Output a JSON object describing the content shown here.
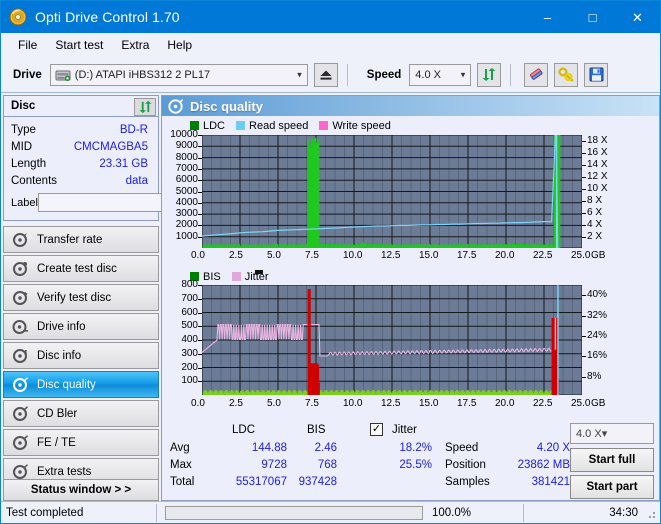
{
  "window": {
    "title": "Opti Drive Control 1.70",
    "icon": "disc-icon",
    "minimize": "–",
    "maximize": "□",
    "close": "✕"
  },
  "menu": [
    {
      "label": "File",
      "name": "menu-file"
    },
    {
      "label": "Start test",
      "name": "menu-start-test"
    },
    {
      "label": "Extra",
      "name": "menu-extra"
    },
    {
      "label": "Help",
      "name": "menu-help"
    }
  ],
  "toolbar": {
    "drive_label": "Drive",
    "drive_value": "(D:)  ATAPI iHBS312  2 PL17",
    "eject_icon": "eject-icon",
    "speed_label": "Speed",
    "speed_value": "4.0 X",
    "refresh_icon": "refresh-icon",
    "eraser_icon": "eraser-icon",
    "tools_icon": "tools-icon",
    "save_icon": "save-icon"
  },
  "disc": {
    "header": "Disc",
    "refresh_icon": "refresh-icon",
    "rows": [
      {
        "key": "Type",
        "value": "BD-R"
      },
      {
        "key": "MID",
        "value": "CMCMAGBA5"
      },
      {
        "key": "Length",
        "value": "23.31 GB"
      },
      {
        "key": "Contents",
        "value": "data"
      }
    ],
    "label_key": "Label",
    "label_value": "",
    "label_placeholder": "",
    "label_button_icon": "cd-disc-icon"
  },
  "nav": {
    "items": [
      {
        "label": "Transfer rate",
        "icon": "disc-speed-icon",
        "selected": false
      },
      {
        "label": "Create test disc",
        "icon": "disc-write-icon",
        "selected": false
      },
      {
        "label": "Verify test disc",
        "icon": "disc-verify-icon",
        "selected": false
      },
      {
        "label": "Drive info",
        "icon": "drive-info-icon",
        "selected": false
      },
      {
        "label": "Disc info",
        "icon": "disc-info-icon",
        "selected": false
      },
      {
        "label": "Disc quality",
        "icon": "disc-quality-icon",
        "selected": true
      },
      {
        "label": "CD Bler",
        "icon": "cd-bler-icon",
        "selected": false
      },
      {
        "label": "FE / TE",
        "icon": "fete-icon",
        "selected": false
      },
      {
        "label": "Extra tests",
        "icon": "extra-tests-icon",
        "selected": false
      }
    ],
    "status_window": "Status window > >"
  },
  "panel": {
    "title": "Disc quality",
    "icon": "disc-quality-icon"
  },
  "chart_data": [
    {
      "name": "top-chart",
      "type": "line",
      "title": "",
      "xlabel": "GB",
      "ylabel": "",
      "xlim": [
        0,
        25
      ],
      "ylim": [
        0,
        10000
      ],
      "y2lim": [
        0,
        18
      ],
      "y2label": "X",
      "grid": true,
      "legend_position": "top-left",
      "xticks": [
        "0.0",
        "2.5",
        "5.0",
        "7.5",
        "10.0",
        "12.5",
        "15.0",
        "17.5",
        "20.0",
        "22.5",
        "25.0"
      ],
      "yticks": [
        "10000",
        "9000",
        "8000",
        "7000",
        "6000",
        "5000",
        "4000",
        "3000",
        "2000",
        "1000"
      ],
      "y2ticks": [
        "18 X",
        "16 X",
        "14 X",
        "12 X",
        "10 X",
        "8 X",
        "6 X",
        "4 X",
        "2 X"
      ],
      "legend": [
        {
          "label": "LDC",
          "color": "#008000"
        },
        {
          "label": "Read speed",
          "color": "#6ecbf5"
        },
        {
          "label": "Write speed",
          "color": "#ff66cc"
        }
      ],
      "series": [
        {
          "name": "LDC",
          "color": "#1ec81e",
          "kind": "bar",
          "x": [
            0.1,
            0.4,
            0.8,
            1.2,
            1.6,
            2.0,
            2.4,
            2.8,
            3.2,
            3.6,
            4.0,
            4.4,
            4.8,
            5.2,
            5.6,
            6.0,
            6.4,
            6.8,
            7.0,
            7.15,
            7.25,
            7.35,
            7.45,
            7.55,
            7.65,
            7.8,
            8.2,
            8.6,
            9.0,
            9.4,
            9.8,
            10.2,
            10.6,
            11.0,
            11.4,
            11.8,
            12.2,
            12.6,
            13.0,
            13.4,
            13.8,
            14.2,
            14.6,
            15.0,
            15.4,
            15.8,
            16.2,
            16.6,
            17.0,
            17.4,
            17.8,
            18.2,
            18.6,
            19.0,
            19.4,
            19.8,
            20.2,
            20.6,
            21.0,
            21.4,
            21.8,
            22.2,
            22.6,
            23.0,
            23.2,
            23.3,
            23.4,
            23.5
          ],
          "values": [
            140,
            200,
            160,
            230,
            180,
            250,
            200,
            170,
            260,
            190,
            220,
            280,
            200,
            240,
            180,
            300,
            220,
            190,
            9600,
            9100,
            9700,
            9200,
            9750,
            9300,
            9650,
            250,
            300,
            220,
            260,
            330,
            240,
            280,
            500,
            260,
            300,
            230,
            280,
            320,
            240,
            290,
            250,
            310,
            230,
            270,
            300,
            250,
            280,
            330,
            260,
            240,
            300,
            270,
            310,
            250,
            290,
            260,
            330,
            280,
            250,
            300,
            270,
            290,
            250,
            300,
            11800,
            11800,
            11800,
            11800,
            280
          ]
        },
        {
          "name": "Read speed",
          "color": "#7fd4f7",
          "kind": "line",
          "x": [
            0,
            0.5,
            1.0,
            1.5,
            2.0,
            2.5,
            3.0,
            3.5,
            4.0,
            4.5,
            5.0,
            5.5,
            6.0,
            6.5,
            7.0,
            7.5,
            8.0,
            8.5,
            9.0,
            9.5,
            10.0,
            10.5,
            11.0,
            11.5,
            12.0,
            12.5,
            13.0,
            13.5,
            14.0,
            14.5,
            15.0,
            15.5,
            16.0,
            16.5,
            17.0,
            17.5,
            18.0,
            18.5,
            19.0,
            19.5,
            20.0,
            20.5,
            21.0,
            21.5,
            22.0,
            22.5,
            23.0,
            23.25,
            23.3,
            23.4
          ],
          "values_x": [
            1.9,
            2.0,
            2.1,
            2.2,
            2.3,
            2.4,
            2.5,
            2.55,
            2.6,
            2.7,
            2.8,
            2.85,
            2.9,
            2.95,
            3.0,
            3.05,
            3.1,
            3.15,
            3.2,
            3.3,
            3.35,
            3.4,
            3.45,
            3.5,
            3.5,
            3.55,
            3.6,
            3.6,
            3.65,
            3.7,
            3.7,
            3.75,
            3.75,
            3.8,
            3.8,
            3.85,
            3.9,
            3.9,
            3.95,
            3.95,
            4.0,
            4.05,
            4.05,
            4.1,
            4.15,
            4.2,
            4.2,
            18.0,
            18.0,
            0
          ]
        }
      ]
    },
    {
      "name": "bottom-chart",
      "type": "line",
      "title": "",
      "xlabel": "GB",
      "ylabel": "",
      "xlim": [
        0,
        25
      ],
      "ylim": [
        0,
        800
      ],
      "y2lim": [
        0,
        40
      ],
      "y2label": "%",
      "grid": true,
      "legend_position": "top-left",
      "xticks": [
        "0.0",
        "2.5",
        "5.0",
        "7.5",
        "10.0",
        "12.5",
        "15.0",
        "17.5",
        "20.0",
        "22.5",
        "25.0"
      ],
      "yticks": [
        "800",
        "700",
        "600",
        "500",
        "400",
        "300",
        "200",
        "100"
      ],
      "y2ticks": [
        "40%",
        "32%",
        "24%",
        "16%",
        "8%"
      ],
      "legend": [
        {
          "label": "BIS",
          "color": "#008000"
        },
        {
          "label": "Jitter",
          "color": "#e0a8d8"
        }
      ],
      "series": [
        {
          "name": "BIS",
          "color": "#d00000",
          "kind": "bar",
          "x": [
            7.05,
            7.1,
            7.15,
            7.2,
            7.25,
            7.3,
            7.35,
            7.4,
            7.45,
            7.5,
            7.55,
            7.6,
            7.65,
            23.1,
            23.2,
            23.3,
            23.4
          ],
          "values": [
            770,
            120,
            100,
            160,
            90,
            200,
            130,
            110,
            230,
            140,
            100,
            220,
            90,
            560,
            560,
            560,
            120
          ]
        },
        {
          "name": "Jitter",
          "color": "#e8b4e0",
          "kind": "line",
          "x": [
            0,
            1,
            2,
            3,
            4,
            5,
            6,
            7,
            7.5,
            8,
            9,
            10,
            12,
            14,
            16,
            18,
            20,
            22,
            23,
            23.2
          ],
          "values_pct": [
            15.5,
            19,
            24,
            24,
            24,
            24,
            24,
            20,
            24,
            14.5,
            15,
            16,
            16.5,
            17,
            17,
            17,
            17,
            17.5,
            26,
            8
          ]
        }
      ]
    }
  ],
  "stats": {
    "col_headers": [
      "LDC",
      "BIS"
    ],
    "rows": [
      {
        "key": "Avg",
        "ldc": "144.88",
        "bis": "2.46"
      },
      {
        "key": "Max",
        "ldc": "9728",
        "bis": "768"
      },
      {
        "key": "Total",
        "ldc": "55317067",
        "bis": "937428"
      }
    ],
    "jitter_label": "Jitter",
    "jitter_checked": true,
    "jitter_avg": "18.2%",
    "jitter_max": "25.5%",
    "speed_key": "Speed",
    "speed_value": "4.20 X",
    "position_key": "Position",
    "position_value": "23862 MB",
    "samples_key": "Samples",
    "samples_value": "381421",
    "speed_select": "4.0 X",
    "start_full": "Start full",
    "start_part": "Start part"
  },
  "statusbar": {
    "text": "Test completed",
    "progress_percent": "100.0%",
    "progress_value": 100,
    "elapsed": "34:30"
  },
  "colors": {
    "accent": "#0078d7",
    "plot_bg": "#6c7c96",
    "ldc_green": "#1ec81e",
    "read_speed": "#7fd4f7",
    "jitter_pink": "#e8b4e0",
    "bis_red": "#d00000",
    "progress_green": "#16b016",
    "value_blue": "#2020e0"
  }
}
